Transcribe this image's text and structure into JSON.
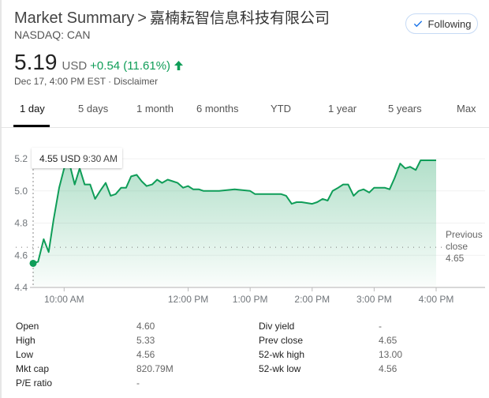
{
  "header": {
    "breadcrumb_root": "Market Summary",
    "separator": ">",
    "company_name": "嘉楠耘智信息科技有限公司",
    "exchange_ticker": "NASDAQ: CAN",
    "follow_button": {
      "label": "Following",
      "icon": "check-icon",
      "state": "following"
    }
  },
  "quote": {
    "price": "5.19",
    "currency": "USD",
    "change": "+0.54 (11.61%)",
    "direction": "up",
    "direction_icon": "arrow-up-icon",
    "timestamp": "Dec 17, 4:00 PM EST",
    "dot": "·",
    "disclaimer_link": "Disclaimer",
    "up_color": "#0f9d58"
  },
  "tabs": [
    {
      "label": "1 day",
      "active": true
    },
    {
      "label": "5 days",
      "active": false
    },
    {
      "label": "1 month",
      "active": false
    },
    {
      "label": "6 months",
      "active": false
    },
    {
      "label": "YTD",
      "active": false
    },
    {
      "label": "1 year",
      "active": false
    },
    {
      "label": "5 years",
      "active": false
    },
    {
      "label": "Max",
      "active": false
    }
  ],
  "chart_data": {
    "type": "area",
    "title": "",
    "xlabel": "",
    "ylabel": "",
    "ylim": [
      4.4,
      5.25
    ],
    "xlim_hours": [
      9.5,
      16.0
    ],
    "y_ticks": [
      "5.2",
      "5.0",
      "4.8",
      "4.6",
      "4.4"
    ],
    "y_tick_values": [
      5.2,
      5.0,
      4.8,
      4.6,
      4.4
    ],
    "x_ticks": [
      "10:00 AM",
      "12:00 PM",
      "1:00 PM",
      "2:00 PM",
      "3:00 PM",
      "4:00 PM"
    ],
    "x_tick_values": [
      10,
      12,
      13,
      14,
      15,
      16
    ],
    "grid": true,
    "line_color": "#0f9d58",
    "previous_close": {
      "label_line1": "Previous",
      "label_line2": "close",
      "value": 4.65,
      "value_text": "4.65"
    },
    "tooltip": {
      "price": "4.55 USD",
      "time": "9:30 AM",
      "x_hours": 9.5,
      "y": 4.55
    },
    "series": [
      {
        "name": "CAN",
        "x_hours": [
          9.5,
          9.58,
          9.67,
          9.75,
          9.83,
          9.92,
          10.0,
          10.08,
          10.17,
          10.25,
          10.33,
          10.42,
          10.5,
          10.58,
          10.67,
          10.75,
          10.83,
          10.92,
          11.0,
          11.08,
          11.17,
          11.25,
          11.33,
          11.42,
          11.5,
          11.58,
          11.67,
          11.75,
          11.83,
          11.92,
          12.0,
          12.08,
          12.17,
          12.25,
          12.33,
          12.5,
          12.75,
          13.0,
          13.08,
          13.25,
          13.5,
          13.58,
          13.67,
          13.75,
          13.83,
          14.0,
          14.08,
          14.17,
          14.25,
          14.33,
          14.42,
          14.5,
          14.58,
          14.67,
          14.75,
          14.83,
          14.92,
          15.0,
          15.08,
          15.17,
          15.25,
          15.33,
          15.42,
          15.5,
          15.58,
          15.67,
          15.75,
          15.83,
          15.92,
          16.0
        ],
        "values": [
          4.55,
          4.56,
          4.7,
          4.62,
          4.82,
          5.02,
          5.14,
          5.18,
          5.04,
          5.14,
          5.04,
          5.04,
          4.95,
          5.0,
          5.05,
          4.97,
          4.98,
          5.02,
          5.02,
          5.09,
          5.1,
          5.06,
          5.03,
          5.04,
          5.07,
          5.05,
          5.07,
          5.06,
          5.05,
          5.02,
          5.03,
          5.01,
          5.01,
          5.0,
          5.0,
          5.0,
          5.01,
          5.0,
          4.98,
          4.98,
          4.98,
          4.97,
          4.92,
          4.93,
          4.93,
          4.92,
          4.93,
          4.95,
          4.94,
          5.0,
          5.02,
          5.04,
          5.04,
          4.97,
          5.0,
          5.01,
          4.99,
          5.02,
          5.02,
          5.02,
          5.01,
          5.08,
          5.17,
          5.14,
          5.15,
          5.13,
          5.19,
          5.19,
          5.19,
          5.19
        ]
      }
    ]
  },
  "stats": {
    "left": [
      {
        "label": "Open",
        "value": "4.60"
      },
      {
        "label": "High",
        "value": "5.33"
      },
      {
        "label": "Low",
        "value": "4.56"
      },
      {
        "label": "Mkt cap",
        "value": "820.79M"
      },
      {
        "label": "P/E ratio",
        "value": "-"
      }
    ],
    "right": [
      {
        "label": "Div yield",
        "value": "-"
      },
      {
        "label": "Prev close",
        "value": "4.65"
      },
      {
        "label": "52-wk high",
        "value": "13.00"
      },
      {
        "label": "52-wk low",
        "value": "4.56"
      }
    ]
  }
}
